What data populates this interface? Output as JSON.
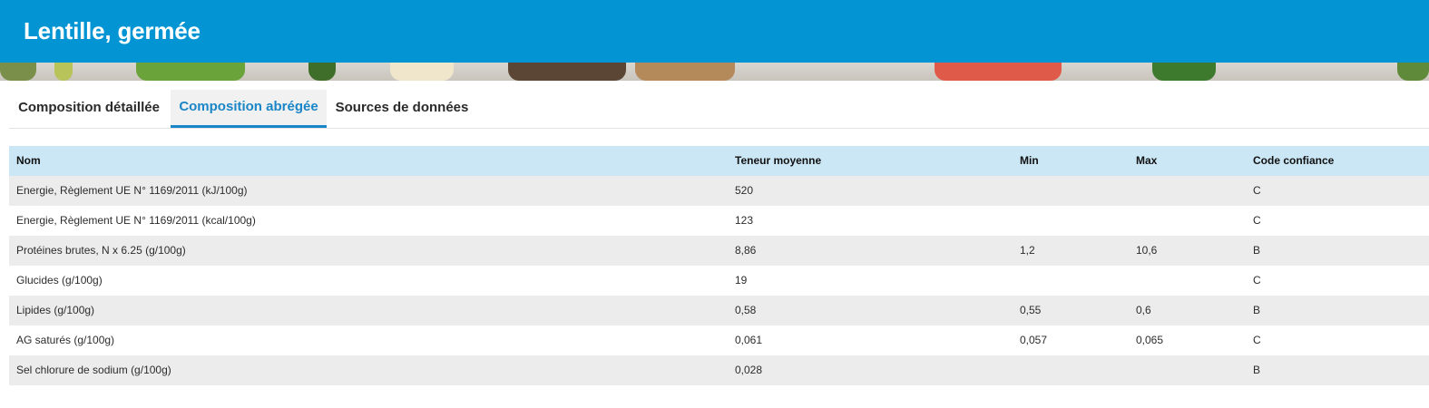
{
  "header": {
    "title": "Lentille, germée",
    "bg_color": "#0395d3"
  },
  "tabs": [
    {
      "label": "Composition détaillée",
      "active": false
    },
    {
      "label": "Composition abrégée",
      "active": true
    },
    {
      "label": "Sources de données",
      "active": false
    }
  ],
  "table": {
    "columns": [
      "Nom",
      "Teneur moyenne",
      "Min",
      "Max",
      "Code confiance"
    ],
    "rows": [
      [
        "Energie, Règlement UE N° 1169/2011 (kJ/100g)",
        "520",
        "",
        "",
        "C"
      ],
      [
        "Energie, Règlement UE N° 1169/2011 (kcal/100g)",
        "123",
        "",
        "",
        "C"
      ],
      [
        "Protéines brutes, N x 6.25 (g/100g)",
        "8,86",
        "1,2",
        "10,6",
        "B"
      ],
      [
        "Glucides (g/100g)",
        "19",
        "",
        "",
        "C"
      ],
      [
        "Lipides (g/100g)",
        "0,58",
        "0,55",
        "0,6",
        "B"
      ],
      [
        "AG saturés (g/100g)",
        "0,061",
        "0,057",
        "0,065",
        "C"
      ],
      [
        "Sel chlorure de sodium (g/100g)",
        "0,028",
        "",
        "",
        "B"
      ]
    ]
  },
  "colors": {
    "accent": "#1a86c7",
    "header_row": "#cbe7f5",
    "stripe": "#ececec"
  }
}
